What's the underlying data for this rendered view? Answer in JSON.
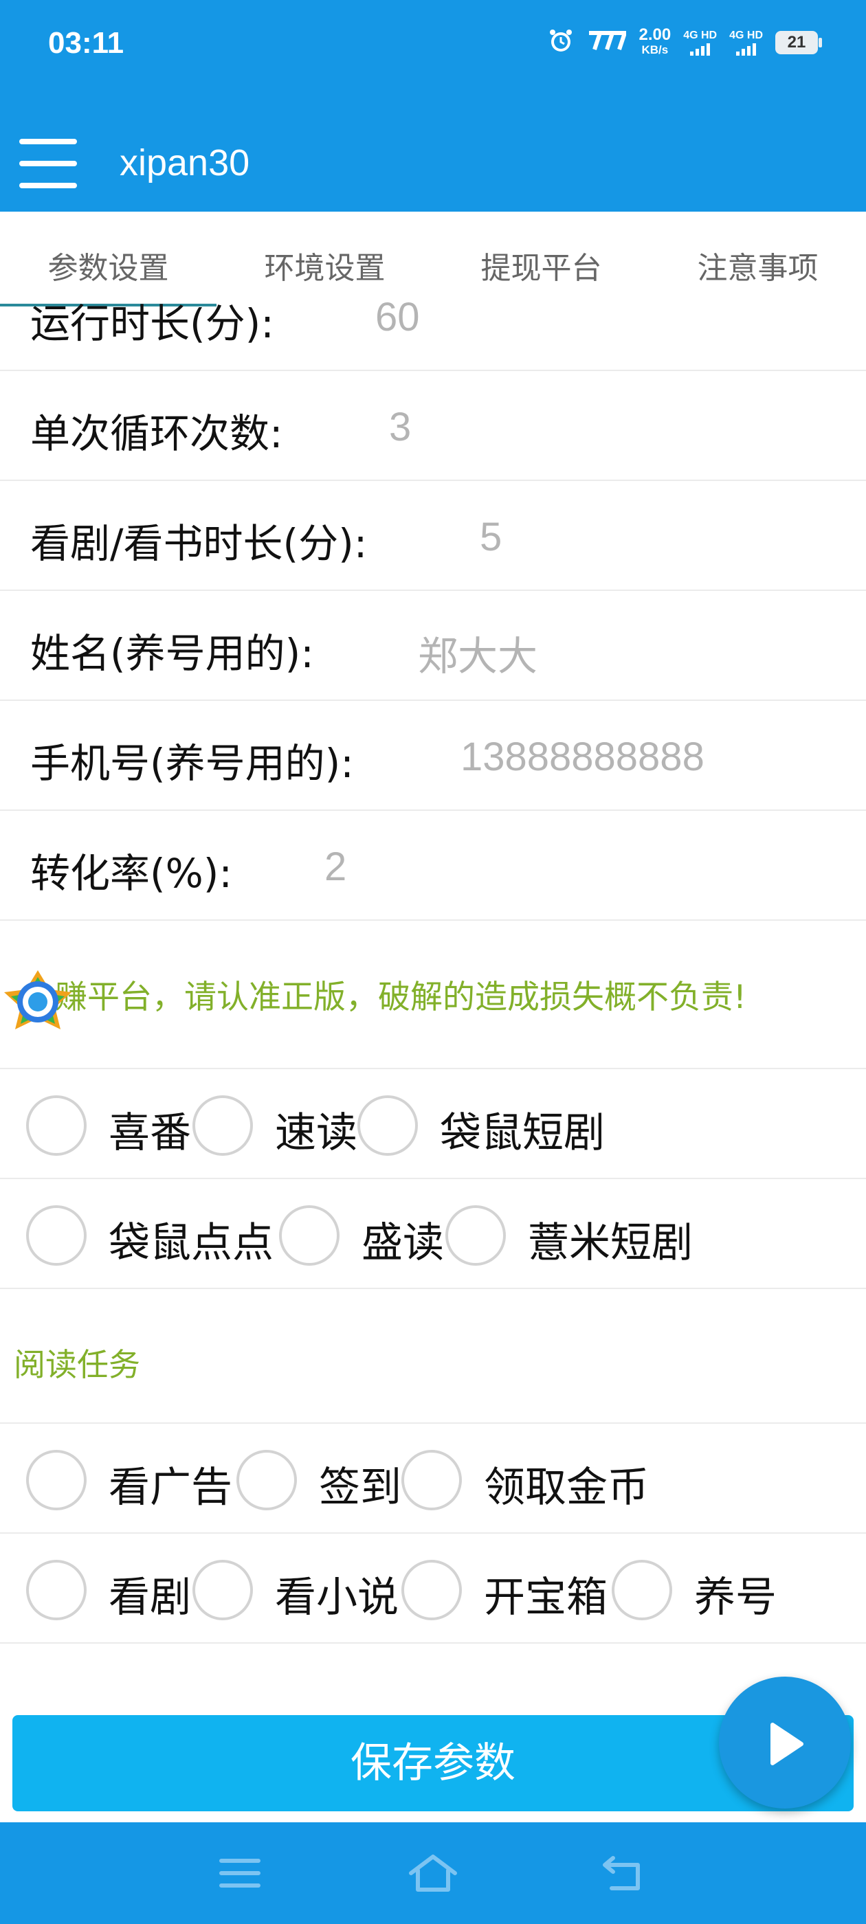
{
  "status_bar": {
    "time": "03:11",
    "speed_value": "2.00",
    "speed_unit": "KB/s",
    "network_1": "4G HD",
    "network_2": "4G HD",
    "battery": "21",
    "icons": [
      "alarm-icon",
      "carrier-icon",
      "signal-icon",
      "battery-icon"
    ]
  },
  "app_bar": {
    "title": "xipan30",
    "menu_icon": "hamburger-menu-icon"
  },
  "tabs": [
    {
      "label": "参数设置",
      "active": true
    },
    {
      "label": "环境设置",
      "active": false
    },
    {
      "label": "提现平台",
      "active": false
    },
    {
      "label": "注意事项",
      "active": false
    }
  ],
  "form": {
    "fields": [
      {
        "label": "运行时长(分):",
        "placeholder": "60"
      },
      {
        "label": "单次循环次数:",
        "placeholder": "3"
      },
      {
        "label": "看剧/看书时长(分):",
        "placeholder": "5"
      },
      {
        "label": "姓名(养号用的):",
        "placeholder": "郑大大"
      },
      {
        "label": "手机号(养号用的):",
        "placeholder": "13888888888"
      },
      {
        "label": "转化率(%):",
        "placeholder": "2"
      }
    ]
  },
  "notice": {
    "text": "赚平台，请认准正版，破解的造成损失概不负责!"
  },
  "platforms": {
    "row1": [
      "喜番",
      "速读",
      "袋鼠短剧"
    ],
    "row2": [
      "袋鼠点点",
      "盛读",
      "薏米短剧"
    ]
  },
  "reading_tasks": {
    "title": "阅读任务",
    "row1": [
      "看广告",
      "签到",
      "领取金币"
    ],
    "row2": [
      "看剧",
      "看小说",
      "开宝箱",
      "养号"
    ]
  },
  "actions": {
    "save_label": "保存参数",
    "fab_icon": "play-icon"
  },
  "nav_bar": {
    "icons": [
      "menu-icon",
      "home-icon",
      "back-icon"
    ]
  },
  "colors": {
    "primary": "#1597e5",
    "button": "#10b3f0",
    "accent_green": "#82b02a",
    "placeholder": "#b4b4b4"
  }
}
